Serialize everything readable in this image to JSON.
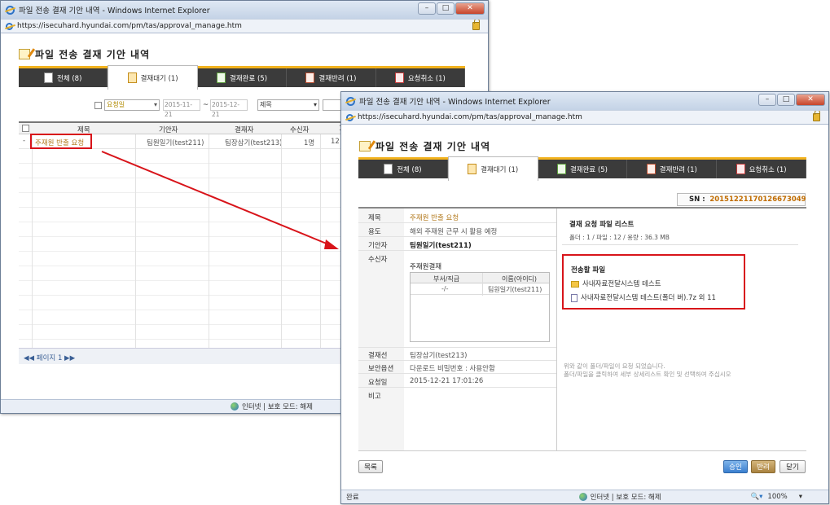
{
  "back_window": {
    "title": "파일 전송 결재 기안 내역 - Windows Internet Explorer",
    "url": "https://isecuhard.hyundai.com/pm/tas/approval_manage.htm",
    "page_title": "파일 전송 결재 기안 내역",
    "tabs": [
      {
        "label": "전체 (8)",
        "icon": "document-icon"
      },
      {
        "label": "결재대기 (1)",
        "icon": "clock-icon"
      },
      {
        "label": "결재완료 (5)",
        "icon": "check-icon"
      },
      {
        "label": "결재반려 (1)",
        "icon": "reject-icon"
      },
      {
        "label": "요청취소 (1)",
        "icon": "cancel-icon"
      }
    ],
    "filter": {
      "date_type": "요청일",
      "date_from": "2015-11-21",
      "date_sep": "~",
      "date_to": "2015-12-21",
      "field": "제목"
    },
    "table": {
      "columns": [
        "제목",
        "기안자",
        "결재자",
        "수신자",
        "1"
      ],
      "rows": [
        {
          "expander": "-",
          "title": "주재원 반출 요청",
          "drafter": "팀원일기(test211)",
          "approver": "팀장삼기(test213)",
          "recipient": "1명",
          "extra": "12"
        }
      ]
    },
    "pagination": "◀◀ 페이지 1 ▶▶",
    "status": "인터넷 | 보호 모드: 해제"
  },
  "front_window": {
    "title": "파일 전송 결재 기안 내역 - Windows Internet Explorer",
    "url": "https://isecuhard.hyundai.com/pm/tas/approval_manage.htm",
    "page_title": "파일 전송 결재 기안 내역",
    "tabs": [
      {
        "label": "전체 (8)",
        "icon": "document-icon"
      },
      {
        "label": "결재대기 (1)",
        "icon": "clock-icon"
      },
      {
        "label": "결재완료 (5)",
        "icon": "check-icon"
      },
      {
        "label": "결재반려 (1)",
        "icon": "reject-icon"
      },
      {
        "label": "요청취소 (1)",
        "icon": "cancel-icon"
      }
    ],
    "sn_label": "SN :",
    "sn_value": "20151221170126673049",
    "details": {
      "title_label": "제목",
      "title_value": "주재원 반출 요청",
      "purpose_label": "용도",
      "purpose_value": "해외 주재원 근무 시 활용 예정",
      "drafter_label": "기안자",
      "drafter_value": "팀원일기(test211)",
      "recipient_label": "수신자",
      "recipient_group": "주재원결재",
      "recipient_cols": [
        "부서/직급",
        "이름(아이디)"
      ],
      "recipient_row": [
        "-/-",
        "팀원일기(test211)"
      ],
      "approver_label": "결재선",
      "approver_value": "팀장삼기(test213)",
      "option_label": "보안옵션",
      "option_value": "다운로드 비밀번호 : 사용안함",
      "date_label": "요청일",
      "date_value": "2015-12-21 17:01:26",
      "note_label": "비고"
    },
    "file_list": {
      "heading": "결재 요청 파일 리스트",
      "summary": "폴더 : 1 / 파일 : 12 / 용량 : 36.3 MB",
      "box_title": "전송할 파일",
      "folder": "사내자료전달시스템 테스트",
      "file": "사내자료전달시스템 테스트(폴더 버).7z 외 11",
      "note1": "위와 같이 폴더/파일이 요청 되었습니다.",
      "note2": "폴더/파일을 클릭하여 세부 상세리스트 확인 및 선택하여 주십시오"
    },
    "buttons": {
      "list": "목록",
      "approve": "승인",
      "reject": "반려",
      "close": "닫기"
    },
    "status": {
      "left": "완료",
      "mid": "인터넷 | 보호 모드: 해제",
      "zoom": "100%"
    }
  }
}
